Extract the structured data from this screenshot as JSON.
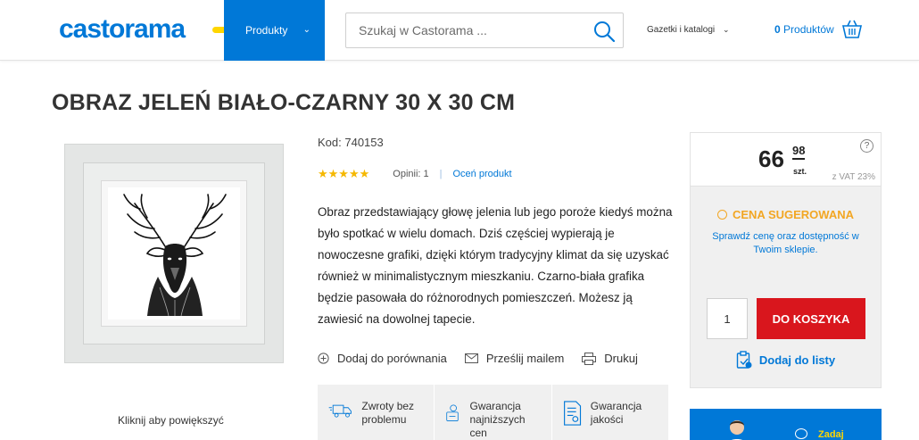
{
  "header": {
    "logo_text": "castorama",
    "menu_label": "Produkty",
    "search_placeholder": "Szukaj w Castorama ...",
    "catalog_label": "Gazetki i katalogi",
    "cart_count": "0",
    "cart_label": "Produktów"
  },
  "product": {
    "title": "OBRAZ JELEŃ BIAŁO-CZARNY 30 X 30 CM",
    "code_label": "Kod: 740153",
    "rating_stars": 5,
    "stars_glyphs": "★★★★★",
    "reviews_label": "Opinii: 1",
    "rate_label": "Oceń produkt",
    "description": "Obraz przedstawiający głowę jelenia lub jego poroże kiedyś można było spotkać w wielu domach. Dziś częściej wypierają je nowoczesne grafiki, dzięki którym tradycyjny klimat da się uzyskać również w minimalistycznym mieszkaniu. Czarno-biała grafika będzie pasowała do różnorodnych pomieszczeń. Możesz ją zawiesić na dowolnej tapecie.",
    "enlarge_label": "Kliknij aby powiększyć"
  },
  "actions": {
    "compare_label": "Dodaj do porównania",
    "email_label": "Prześlij mailem",
    "print_label": "Drukuj"
  },
  "benefits": [
    {
      "label": "Zwroty bez problemu",
      "icon": "truck-icon"
    },
    {
      "label": "Gwarancja najniższych cen",
      "icon": "price-tag-icon"
    },
    {
      "label": "Gwarancja jakości",
      "icon": "certificate-icon"
    }
  ],
  "price": {
    "integer": "66",
    "decimal": "98",
    "unit": "szt.",
    "vat": "z VAT 23%",
    "help": "?",
    "suggested_label": "CENA SUGEROWANA",
    "check_note": "Sprawdź cenę oraz dostępność w Twoim sklepie.",
    "quantity": "1",
    "add_to_cart": "DO KOSZYKA",
    "add_to_list": "Dodaj do listy"
  },
  "ask": {
    "label": "Zadaj"
  },
  "colors": {
    "brand_blue": "#0078d7",
    "accent_yellow": "#ffd600",
    "cart_red": "#d9161d",
    "suggested_orange": "#f2a623"
  }
}
